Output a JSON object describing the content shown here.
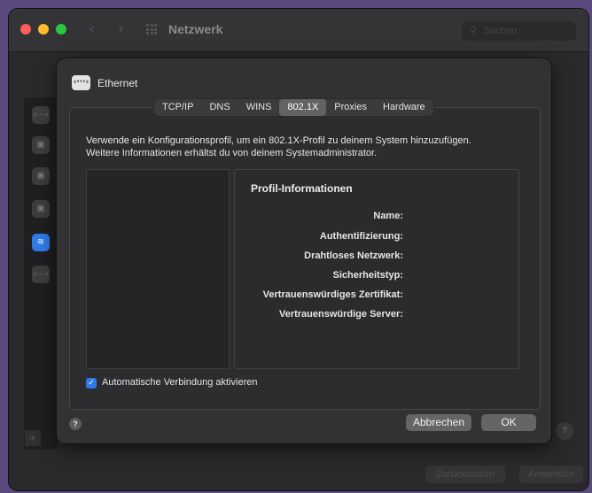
{
  "window": {
    "title": "Netzwerk",
    "search_placeholder": "Suchen",
    "traffic_lights": [
      "#ff5f57",
      "#febc2e",
      "#28c840"
    ],
    "reset_label": "Zurücksetzen",
    "apply_label": "Anwenden",
    "plus_label": "+",
    "help_label": "?"
  },
  "sheet": {
    "interface_name": "Ethernet",
    "tabs": [
      {
        "label": "TCP/IP"
      },
      {
        "label": "DNS"
      },
      {
        "label": "WINS"
      },
      {
        "label": "802.1X",
        "active": true
      },
      {
        "label": "Proxies"
      },
      {
        "label": "Hardware"
      }
    ],
    "description_line1": "Verwende ein Konfigurationsprofil, um ein 802.1X-Profil zu deinem System hinzuzufügen.",
    "description_line2": "Weitere Informationen erhältst du von deinem Systemadministrator.",
    "profile_info": {
      "title": "Profil-Informationen",
      "fields": [
        "Name:",
        "Authentifizierung:",
        "Drahtloses Netzwerk:",
        "Sicherheitstyp:",
        "Vertrauenswürdiges Zertifikat:",
        "Vertrauenswürdige Server:"
      ]
    },
    "auto_connect": {
      "label": "Automatische Verbindung aktivieren",
      "checked": true
    },
    "help_label": "?",
    "cancel_label": "Abbrechen",
    "ok_label": "OK"
  },
  "icons": {
    "ethernet": "ethernet-icon",
    "lock": "lock-icon",
    "wifi": "wifi-icon"
  },
  "colors": {
    "accent": "#2f7be8",
    "background": "#5b4a7e"
  }
}
